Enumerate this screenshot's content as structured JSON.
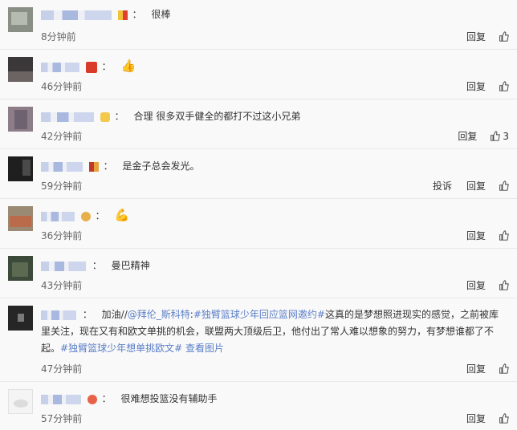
{
  "comments": [
    {
      "text": "很棒",
      "emoji": "",
      "time": "8分钟前",
      "actions": [
        "回复"
      ],
      "likes": "",
      "avatar": "#8a8f86"
    },
    {
      "text": "",
      "emoji": "👍",
      "time": "46分钟前",
      "actions": [
        "回复"
      ],
      "likes": "",
      "avatar": "#3a3838"
    },
    {
      "text": "合理 很多双手健全的都打不过这小兄弟",
      "emoji": "",
      "time": "42分钟前",
      "actions": [
        "回复"
      ],
      "likes": "3",
      "avatar": "#8c7d88"
    },
    {
      "text": "是金子总会发光。",
      "emoji": "",
      "time": "59分钟前",
      "actions": [
        "投诉",
        "回复"
      ],
      "likes": "",
      "avatar": "#1f1f1f"
    },
    {
      "text": "",
      "emoji": "💪",
      "time": "36分钟前",
      "actions": [
        "回复"
      ],
      "likes": "",
      "avatar": "#9b8a73"
    },
    {
      "text": "曼巴精神",
      "emoji": "",
      "time": "43分钟前",
      "actions": [
        "回复"
      ],
      "likes": "",
      "avatar": "#3c4a3a"
    },
    {
      "text_parts": [
        {
          "t": "加油//",
          "link": false
        },
        {
          "t": "@拜伦_斯科特",
          "link": true
        },
        {
          "t": ":",
          "link": false
        },
        {
          "t": "#独臂篮球少年回应篮网邀约#",
          "link": true
        },
        {
          "t": "这真的是梦想照进现实的感觉，之前被库里关注，现在又有和欧文单挑的机会，联盟两大顶级后卫，他付出了常人难以想象的努力，有梦想谁都了不起。",
          "link": false
        },
        {
          "t": "#独臂篮球少年想单挑欧文#",
          "link": true
        },
        {
          "t": " ",
          "link": false
        },
        {
          "t": "查看图片",
          "link": true
        }
      ],
      "time": "47分钟前",
      "actions": [
        "回复"
      ],
      "likes": "",
      "avatar": "#262626"
    },
    {
      "text": "很难想投篮没有辅助手",
      "emoji": "",
      "time": "57分钟前",
      "actions": [
        "回复"
      ],
      "likes": "",
      "avatar": "#f4f4f4"
    }
  ]
}
